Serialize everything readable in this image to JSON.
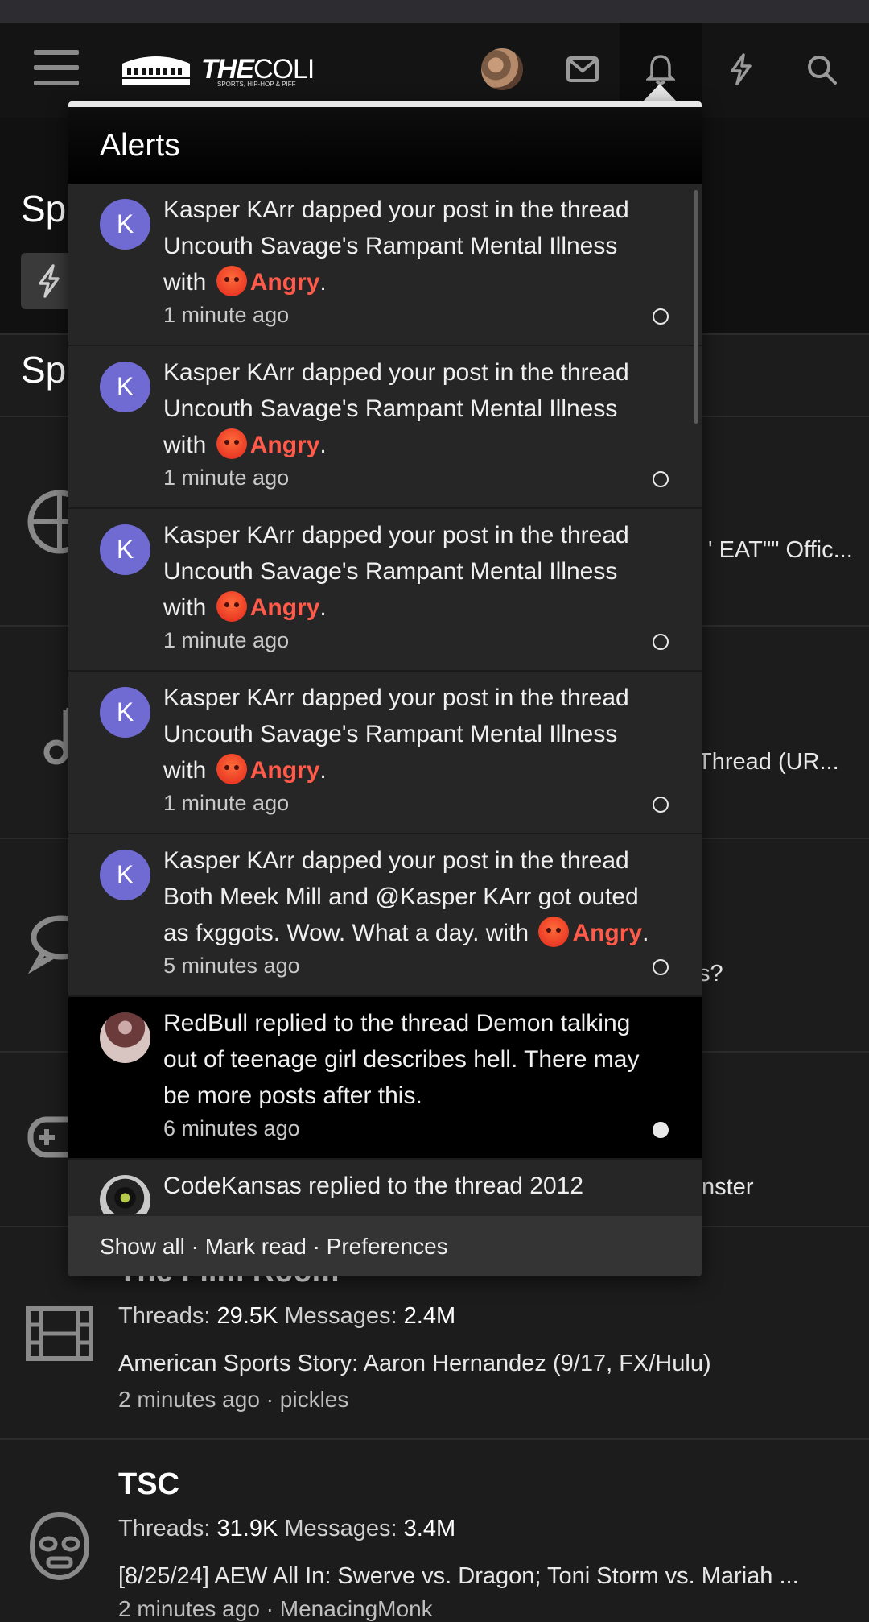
{
  "header": {
    "logo_brand": "THE",
    "logo_brand_thin": "COLI",
    "logo_tagline": "SPORTS, HIP-HOP & PIFF"
  },
  "background": {
    "section_head_1": "Sp",
    "section_head_2": "Sp",
    "peek_texts": [
      "' EAT\"\" Offic...",
      "Thread (UR...",
      "s?",
      "nster"
    ],
    "forums": [
      {
        "title": "The Film Room",
        "threads_label": "Threads:",
        "threads": "29.5K",
        "messages_label": "Messages:",
        "messages": "2.4M",
        "latest": "American Sports Story: Aaron Hernandez (9/17, FX/Hulu)",
        "meta": "2 minutes ago · pickles"
      },
      {
        "title": "TSC",
        "threads_label": "Threads:",
        "threads": "31.9K",
        "messages_label": "Messages:",
        "messages": "3.4M",
        "latest": "[8/25/24] AEW All In: Swerve vs. Dragon; Toni Storm vs. Mariah ...",
        "meta": "2 minutes ago · MenacingMonk"
      }
    ]
  },
  "alerts": {
    "title": "Alerts",
    "items": [
      {
        "avatar_letter": "K",
        "text": "Kasper KArr dapped your post in the thread Uncouth Savage's Rampant Mental Illness with",
        "reaction": "Angry",
        "time": "1 minute ago",
        "read": false
      },
      {
        "avatar_letter": "K",
        "text": "Kasper KArr dapped your post in the thread Uncouth Savage's Rampant Mental Illness with",
        "reaction": "Angry",
        "time": "1 minute ago",
        "read": false
      },
      {
        "avatar_letter": "K",
        "text": "Kasper KArr dapped your post in the thread Uncouth Savage's Rampant Mental Illness with",
        "reaction": "Angry",
        "time": "1 minute ago",
        "read": false
      },
      {
        "avatar_letter": "K",
        "text": "Kasper KArr dapped your post in the thread Uncouth Savage's Rampant Mental Illness with",
        "reaction": "Angry",
        "time": "1 minute ago",
        "read": false
      },
      {
        "avatar_letter": "K",
        "text": "Kasper KArr dapped your post in the thread Both Meek Mill and @Kasper KArr got outed as fxggots. Wow. What a day. with",
        "reaction": "Angry",
        "time": "5 minutes ago",
        "read": false
      },
      {
        "text": "RedBull replied to the thread Demon talking out of teenage girl describes hell. There may be more posts after this.",
        "time": "6 minutes ago",
        "read": true
      },
      {
        "text": "CodeKansas replied to the thread 2012"
      }
    ],
    "footer": {
      "show_all": "Show all",
      "mark_read": "Mark read",
      "preferences": "Preferences",
      "separator": "·"
    }
  },
  "icons": {
    "hamburger": "menu-icon",
    "envelope": "mail-icon",
    "bell": "bell-icon",
    "bolt": "bolt-icon",
    "search": "search-icon"
  },
  "colors": {
    "accent_angry": "#ff5a4a",
    "avatar_letter_bg": "#6f6bd3"
  }
}
